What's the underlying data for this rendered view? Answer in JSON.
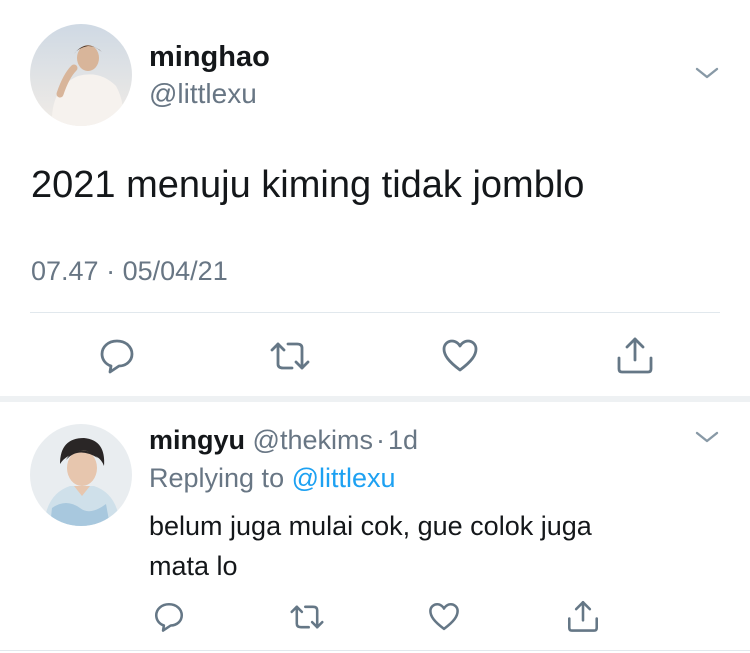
{
  "tweet": {
    "display_name": "minghao",
    "handle": "@littlexu",
    "text": "2021 menuju kiming tidak jomblo",
    "time": "07.47",
    "separator": "·",
    "date": "05/04/21"
  },
  "reply": {
    "display_name": "mingyu",
    "handle": "@thekims",
    "dot": "·",
    "age": "1d",
    "replying_prefix": "Replying to",
    "replying_to": "@littlexu",
    "text_line1": "belum juga mulai cok, gue colok juga",
    "text_line2": "mata lo"
  },
  "icons": {
    "reply": "reply-icon",
    "retweet": "retweet-icon",
    "like": "heart-icon",
    "share": "share-icon",
    "menu": "chevron-down-icon"
  },
  "colors": {
    "icon_gray": "#657786",
    "link_blue": "#1da1f2",
    "divider": "#e1e8ed"
  }
}
